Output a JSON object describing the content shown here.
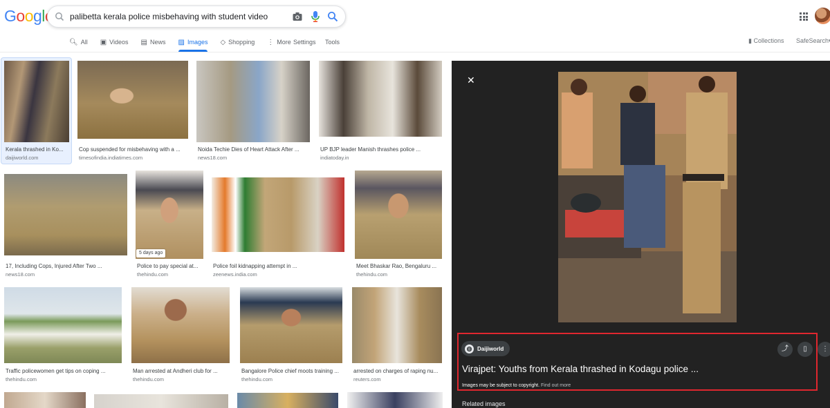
{
  "search": {
    "query": "palibetta kerala police misbehaving with student video"
  },
  "logo": {
    "text": "Google",
    "letters": [
      "G",
      "o",
      "o",
      "g",
      "l",
      "e"
    ],
    "colors": [
      "#4285f4",
      "#ea4335",
      "#fbbc05",
      "#4285f4",
      "#34a853",
      "#ea4335"
    ]
  },
  "tabs": [
    {
      "label": "All",
      "icon": "search-icon"
    },
    {
      "label": "Videos",
      "icon": "play-icon"
    },
    {
      "label": "News",
      "icon": "newspaper-icon"
    },
    {
      "label": "Images",
      "icon": "image-icon",
      "active": true
    },
    {
      "label": "Shopping",
      "icon": "tag-icon"
    },
    {
      "label": "More",
      "icon": "more-vert-icon"
    }
  ],
  "tools": {
    "settings": "Settings",
    "tools": "Tools"
  },
  "right_links": {
    "collections": "Collections",
    "safesearch": "SafeSearch"
  },
  "results": [
    {
      "caption": "Kerala thrashed in Ko...",
      "source": "daijiworld.com"
    },
    {
      "caption": "Cop suspended for misbehaving with a ...",
      "source": "timesofindia.indiatimes.com"
    },
    {
      "caption": "Noida Techie Dies of Heart Attack After ...",
      "source": "news18.com"
    },
    {
      "caption": "UP BJP leader Manish thrashes police ...",
      "source": "indiatoday.in"
    },
    {
      "caption": "17, Including Cops, Injured After Two ...",
      "source": "news18.com"
    },
    {
      "caption": "Police to pay special at...",
      "source": "thehindu.com",
      "badge": "5 days ago"
    },
    {
      "caption": "Police foil kidnapping attempt in ...",
      "source": "zeenews.india.com"
    },
    {
      "caption": "Meet Bhaskar Rao, Bengaluru ...",
      "source": "thehindu.com"
    },
    {
      "caption": "Traffic policewomen get tips on coping ...",
      "source": "thehindu.com"
    },
    {
      "caption": "Man arrested at Andheri club for ...",
      "source": "thehindu.com"
    },
    {
      "caption": "Bangalore Police chief moots training ...",
      "source": "thehindu.com"
    },
    {
      "caption": "arrested on charges of raping nu...",
      "source": "reuters.com"
    }
  ],
  "panel": {
    "source_name": "Daijiworld",
    "title": "Virajpet: Youths from Kerala thrashed in Kodagu police ...",
    "copyright": "Images may be subject to copyright.",
    "find_out_more": "Find out more",
    "related": "Related images"
  }
}
